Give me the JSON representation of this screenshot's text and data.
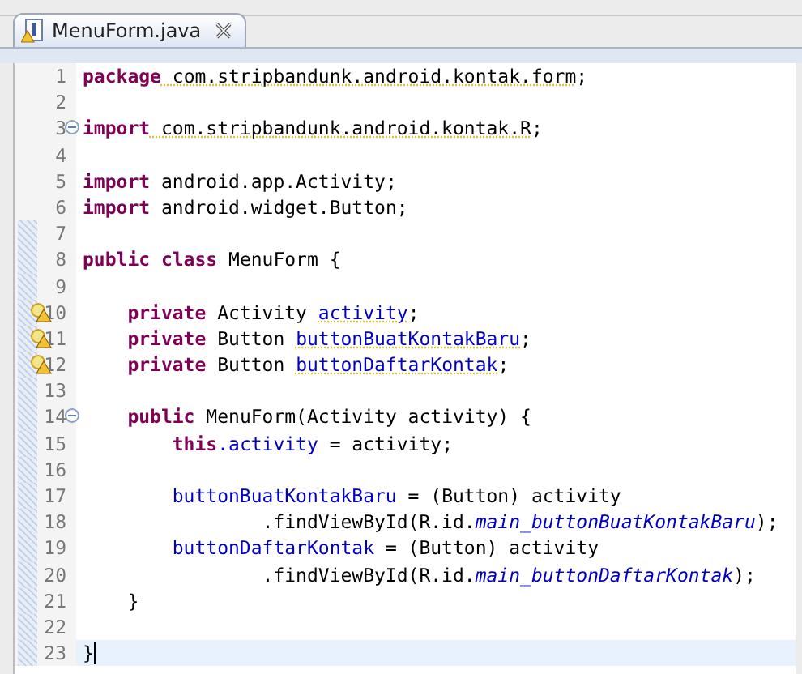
{
  "tab": {
    "title": "MenuForm.java",
    "selected": true
  },
  "lines": [
    {
      "number": "1",
      "warning": false,
      "foldable": false,
      "in_range": false,
      "current": false,
      "tokens": [
        {
          "kind": "keyword",
          "text": "package"
        },
        {
          "kind": "plain",
          "text": " com.stripbandunk.android.kontak.form",
          "spell": true
        },
        {
          "kind": "plain",
          "text": ";"
        }
      ]
    },
    {
      "number": "2",
      "warning": false,
      "foldable": false,
      "in_range": false,
      "current": false
    },
    {
      "number": "3",
      "warning": false,
      "foldable": true,
      "in_range": false,
      "current": false,
      "tokens": [
        {
          "kind": "keyword",
          "text": "import"
        },
        {
          "kind": "plain",
          "text": " com.stripbandunk.android.kontak.R",
          "spell": true
        },
        {
          "kind": "plain",
          "text": ";"
        }
      ]
    },
    {
      "number": "4",
      "warning": false,
      "foldable": false,
      "in_range": false,
      "current": false
    },
    {
      "number": "5",
      "warning": false,
      "foldable": false,
      "in_range": false,
      "current": false,
      "tokens": [
        {
          "kind": "keyword",
          "text": "import"
        },
        {
          "kind": "plain",
          "text": " android.app.Activity;"
        }
      ]
    },
    {
      "number": "6",
      "warning": false,
      "foldable": false,
      "in_range": false,
      "current": false,
      "tokens": [
        {
          "kind": "keyword",
          "text": "import"
        },
        {
          "kind": "plain",
          "text": " android.widget.Button;"
        }
      ]
    },
    {
      "number": "7",
      "warning": false,
      "foldable": false,
      "in_range": true,
      "current": false
    },
    {
      "number": "8",
      "warning": false,
      "foldable": false,
      "in_range": true,
      "current": false,
      "tokens": [
        {
          "kind": "keyword",
          "text": "public class"
        },
        {
          "kind": "plain",
          "text": " MenuForm {"
        }
      ]
    },
    {
      "number": "9",
      "warning": false,
      "foldable": false,
      "in_range": true,
      "current": false
    },
    {
      "number": "10",
      "warning": true,
      "foldable": false,
      "in_range": true,
      "current": false,
      "tokens": [
        {
          "kind": "keyword",
          "text": "    private"
        },
        {
          "kind": "plain",
          "text": " Activity "
        },
        {
          "kind": "field",
          "text": "activity",
          "spell": true
        },
        {
          "kind": "plain",
          "text": ";"
        }
      ]
    },
    {
      "number": "11",
      "warning": true,
      "foldable": false,
      "in_range": true,
      "current": false,
      "tokens": [
        {
          "kind": "keyword",
          "text": "    private"
        },
        {
          "kind": "plain",
          "text": " Button "
        },
        {
          "kind": "field",
          "text": "buttonBuatKontakBaru",
          "spell": true
        },
        {
          "kind": "plain",
          "text": ";"
        }
      ]
    },
    {
      "number": "12",
      "warning": true,
      "foldable": false,
      "in_range": true,
      "current": false,
      "tokens": [
        {
          "kind": "keyword",
          "text": "    private"
        },
        {
          "kind": "plain",
          "text": " Button "
        },
        {
          "kind": "field",
          "text": "buttonDaftarKontak",
          "spell": true
        },
        {
          "kind": "plain",
          "text": ";"
        }
      ]
    },
    {
      "number": "13",
      "warning": false,
      "foldable": false,
      "in_range": true,
      "current": false
    },
    {
      "number": "14",
      "warning": false,
      "foldable": true,
      "in_range": true,
      "current": false,
      "tokens": [
        {
          "kind": "keyword",
          "text": "    public"
        },
        {
          "kind": "plain",
          "text": " MenuForm(Activity activity) {"
        }
      ]
    },
    {
      "number": "15",
      "warning": false,
      "foldable": false,
      "in_range": true,
      "current": false,
      "tokens": [
        {
          "kind": "keyword",
          "text": "        this"
        },
        {
          "kind": "field",
          "text": ".activity"
        },
        {
          "kind": "plain",
          "text": " = activity;"
        }
      ]
    },
    {
      "number": "16",
      "warning": false,
      "foldable": false,
      "in_range": true,
      "current": false
    },
    {
      "number": "17",
      "warning": false,
      "foldable": false,
      "in_range": true,
      "current": false,
      "tokens": [
        {
          "kind": "field",
          "text": "        buttonBuatKontakBaru"
        },
        {
          "kind": "plain",
          "text": " = (Button) activity"
        }
      ]
    },
    {
      "number": "18",
      "warning": false,
      "foldable": false,
      "in_range": true,
      "current": false,
      "tokens": [
        {
          "kind": "plain",
          "text": "                .findViewById(R.id."
        },
        {
          "kind": "static",
          "text": "main_buttonBuatKontakBaru"
        },
        {
          "kind": "plain",
          "text": ");"
        }
      ]
    },
    {
      "number": "19",
      "warning": false,
      "foldable": false,
      "in_range": true,
      "current": false,
      "tokens": [
        {
          "kind": "field",
          "text": "        buttonDaftarKontak"
        },
        {
          "kind": "plain",
          "text": " = (Button) activity"
        }
      ]
    },
    {
      "number": "20",
      "warning": false,
      "foldable": false,
      "in_range": true,
      "current": false,
      "tokens": [
        {
          "kind": "plain",
          "text": "                .findViewById(R.id."
        },
        {
          "kind": "static",
          "text": "main_buttonDaftarKontak"
        },
        {
          "kind": "plain",
          "text": ");"
        }
      ]
    },
    {
      "number": "21",
      "warning": false,
      "foldable": false,
      "in_range": true,
      "current": false,
      "tokens": [
        {
          "kind": "plain",
          "text": "    }"
        }
      ]
    },
    {
      "number": "22",
      "warning": false,
      "foldable": false,
      "in_range": true,
      "current": false
    },
    {
      "number": "23",
      "warning": false,
      "foldable": false,
      "in_range": true,
      "current": true,
      "tokens": [
        {
          "kind": "plain",
          "text": "}"
        }
      ]
    }
  ]
}
